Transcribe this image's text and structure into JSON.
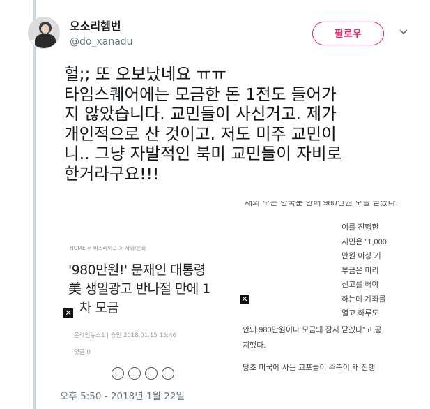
{
  "author": {
    "display_name": "오소리헴번",
    "handle": "@do_xanadu"
  },
  "follow_button": {
    "label": "팔로우"
  },
  "tweet": {
    "lines": [
      "헐;; 또 오보났네요 ㅠㅠ",
      "타임스퀘어에는 모금한 돈 1전도 들어가",
      "지 않았습니다. 교민들이 사신거고. 제가",
      "개인적으로 산 것이고. 저도 미주 교민이",
      "니.. 그냥 자발적인 북미 교민들이 자비로",
      "한거라구요!!!"
    ],
    "timestamp": "오후 5:50 - 2018년 1월 22일"
  },
  "media": {
    "top_cut_text": "재외 모든 한국분 한배 980만원 보을 닫았다.",
    "left_article": {
      "breadcrumb": "HOME  >  비즈라이프  >  사회/문화",
      "headline_lines": [
        "'980만원!' 문재인 대통령",
        "美 생일광고 반나절 만에 1",
        "차 모금"
      ],
      "byline": "온라인뉴스1   |   승인 2018.01.15 15:46",
      "comments": "댓글 0"
    },
    "right_article": {
      "column_lines": [
        "이를    진행한",
        "시민은  \"1,000",
        "만원  이상  기",
        "부금은    미리",
        "신고를    해야",
        "하는데 계좌를",
        "열고   하루도"
      ],
      "wide_lines": [
        "안돼 980만원이나 모금돼 잠시 닫겠다\"고 공",
        "지했다.",
        "당초 미국에 사는 교포들이 주축이 돼 진행"
      ]
    },
    "close_mark": "✕"
  },
  "colors": {
    "accent": "#e0245e",
    "muted": "#657786",
    "thread_line": "#ccd6dd"
  }
}
